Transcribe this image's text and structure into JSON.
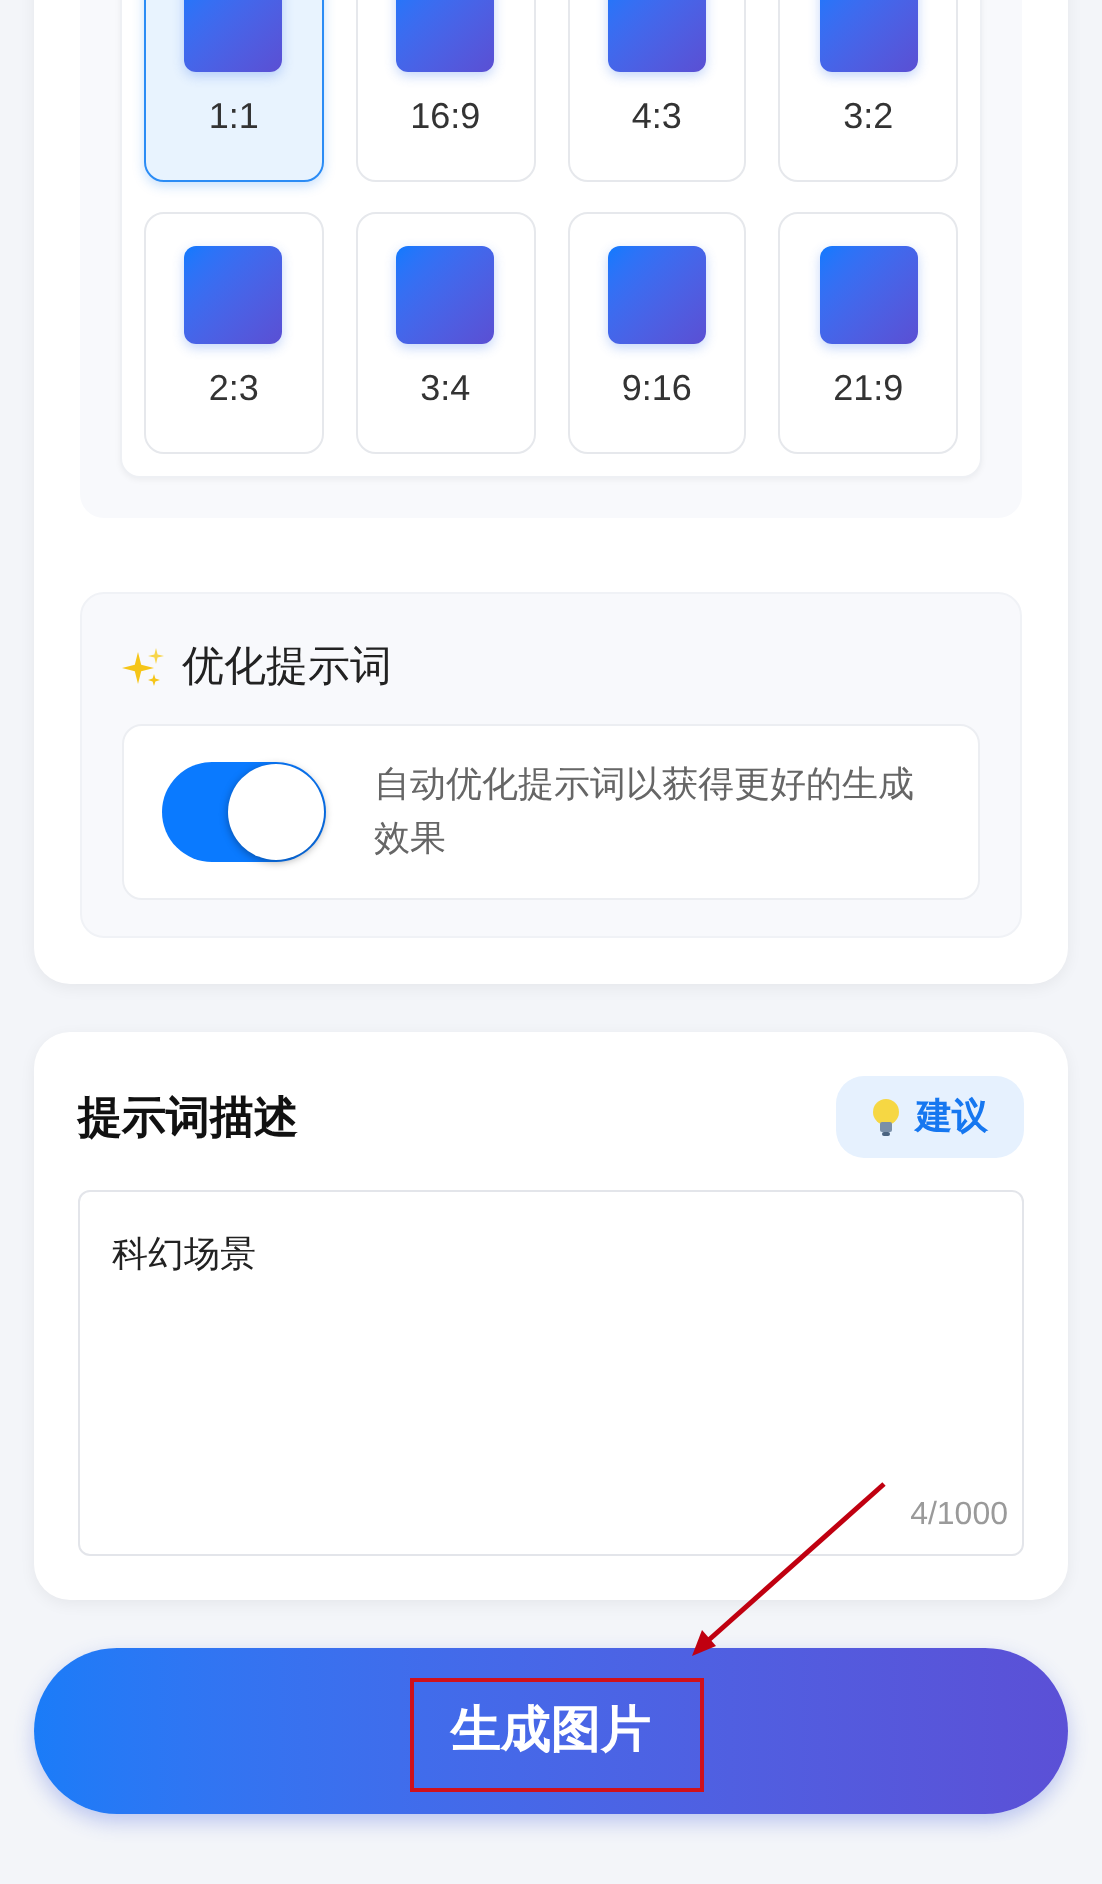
{
  "aspect_ratios": [
    {
      "label": "1:1",
      "selected": true
    },
    {
      "label": "16:9",
      "selected": false
    },
    {
      "label": "4:3",
      "selected": false
    },
    {
      "label": "3:2",
      "selected": false
    },
    {
      "label": "2:3",
      "selected": false
    },
    {
      "label": "3:4",
      "selected": false
    },
    {
      "label": "9:16",
      "selected": false
    },
    {
      "label": "21:9",
      "selected": false
    }
  ],
  "optimize": {
    "title": "优化提示词",
    "on": true,
    "description": "自动优化提示词以获得更好的生成效果"
  },
  "prompt": {
    "title": "提示词描述",
    "suggest_button": "建议",
    "value": "科幻场景",
    "counter": "4/1000"
  },
  "generate_button": "生成图片"
}
